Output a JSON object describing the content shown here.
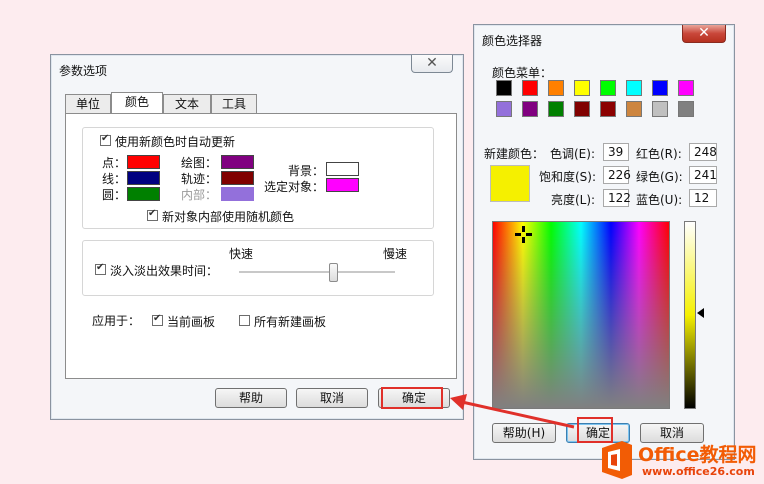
{
  "prefs_dialog": {
    "title": "参数选项",
    "close_glyph": "✕",
    "tabs": [
      {
        "label": "单位",
        "active": false
      },
      {
        "label": "颜色",
        "active": true
      },
      {
        "label": "文本",
        "active": false
      },
      {
        "label": "工具",
        "active": false
      }
    ],
    "auto_update_label": "使用新颜色时自动更新",
    "auto_update_checked": true,
    "color_items": [
      {
        "label": "点：",
        "color": "#ff0000"
      },
      {
        "label": "线：",
        "color": "#000080"
      },
      {
        "label": "圆：",
        "color": "#008000"
      },
      {
        "label": "绘图：",
        "color": "#800080"
      },
      {
        "label": "轨迹：",
        "color": "#800000"
      },
      {
        "label": "内部：",
        "color": "#9370db",
        "disabled": true
      },
      {
        "label": "背景：",
        "color": "#ffffff"
      },
      {
        "label": "选定对象：",
        "color": "#ff00ff"
      }
    ],
    "random_interior_label": "新对象内部使用随机颜色",
    "random_interior_checked": true,
    "fade_label": "淡入淡出效果时间：",
    "fade_checked": true,
    "fast_label": "快速",
    "slow_label": "慢速",
    "fade_slider_fraction": 0.6,
    "apply_label": "应用于：",
    "apply_current_label": "当前画板",
    "apply_current_checked": true,
    "apply_all_label": "所有新建画板",
    "apply_all_checked": false,
    "help_button": "帮助",
    "cancel_button": "取消",
    "ok_button": "确定"
  },
  "color_picker": {
    "title": "颜色选择器",
    "close_glyph": "✕",
    "menu_label": "颜色菜单：",
    "palette": [
      "#000000",
      "#ff0000",
      "#ff8000",
      "#ffff00",
      "#00ff00",
      "#00ffff",
      "#0000ff",
      "#ff00ff",
      "#9370db",
      "#800080",
      "#008000",
      "#800000",
      "#8b0000",
      "#cd853f",
      "#c0c0c0",
      "#808080"
    ],
    "new_color_label": "新建颜色：",
    "new_color": "#f5f000",
    "hue_label": "色调(E):",
    "hue_value": "39",
    "sat_label": "饱和度(S):",
    "sat_value": "226",
    "lum_label": "亮度(L):",
    "lum_value": "122",
    "red_label": "红色(R):",
    "red_value": "248",
    "green_label": "绿色(G):",
    "green_value": "241",
    "blue_label": "蓝色(U):",
    "blue_value": "12",
    "help_button": "帮助(H)",
    "ok_button": "确定",
    "cancel_button": "取消"
  },
  "watermark": {
    "brand": "Office教程网",
    "url": "www.office26.com",
    "icon_colors": [
      "#f25c05",
      "#e8440b"
    ]
  }
}
